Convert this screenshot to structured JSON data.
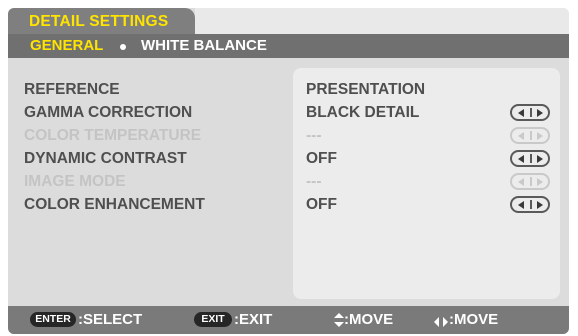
{
  "header": {
    "title": "DETAIL SETTINGS"
  },
  "tabs": {
    "general": "GENERAL",
    "white_balance": "WHITE BALANCE"
  },
  "rows": [
    {
      "label": "REFERENCE",
      "value": "PRESENTATION",
      "enabled": true,
      "has_arrows": false
    },
    {
      "label": "GAMMA CORRECTION",
      "value": "BLACK DETAIL",
      "enabled": true,
      "has_arrows": true
    },
    {
      "label": "COLOR TEMPERATURE",
      "value": "---",
      "enabled": false,
      "has_arrows": true
    },
    {
      "label": "DYNAMIC CONTRAST",
      "value": "OFF",
      "enabled": true,
      "has_arrows": true
    },
    {
      "label": "IMAGE MODE",
      "value": "---",
      "enabled": false,
      "has_arrows": true
    },
    {
      "label": "COLOR ENHANCEMENT",
      "value": "OFF",
      "enabled": true,
      "has_arrows": true
    }
  ],
  "footer": {
    "enter_key": "ENTER",
    "select_label": ":SELECT",
    "exit_key": "EXIT",
    "exit_label": ":EXIT",
    "move_ud_icon": "up-down-arrow-icon",
    "move_ud_label": ":MOVE",
    "move_lr_icon": "left-right-arrow-icon",
    "move_lr_label": ":MOVE"
  },
  "colors": {
    "accent": "#ffe400",
    "enabled_text": "#4f4f4f",
    "disabled_text": "#c4c4c4"
  }
}
